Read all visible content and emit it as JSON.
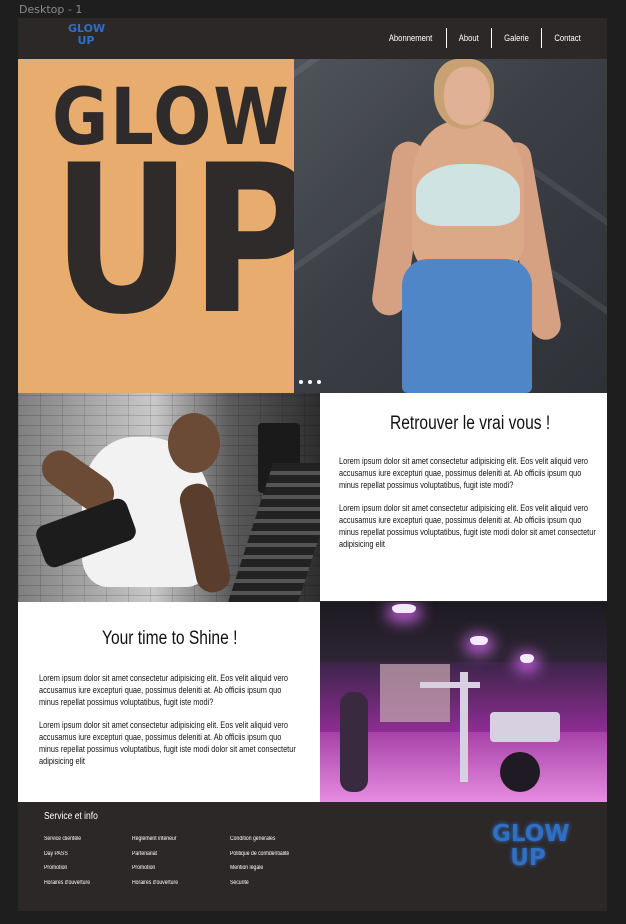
{
  "canvas": {
    "frame_label": "Desktop - 1"
  },
  "header": {
    "logo": {
      "line1": "GLOW",
      "line2": "UP"
    },
    "nav": [
      "Abonnement",
      "About",
      "Galerie",
      "Contact"
    ]
  },
  "hero": {
    "title_line1": "GLOW",
    "title_line2": "UP",
    "carousel_dots": 3
  },
  "section1": {
    "title": "Retrouver le vrai vous !",
    "paragraph1": "Lorem ipsum dolor sit amet consectetur adipisicing elit. Eos velit aliquid vero accusamus iure excepturi quae, possimus deleniti at. Ab officiis ipsum quo minus repellat possimus voluptatibus, fugit iste modi?",
    "paragraph2": "Lorem ipsum dolor sit amet consectetur adipisicing elit. Eos velit aliquid vero accusamus iure excepturi quae, possimus deleniti at. Ab officiis ipsum quo minus repellat possimus voluptatibus, fugit iste modi dolor sit amet consectetur adipisicing elit"
  },
  "section2": {
    "title": "Your time to Shine !",
    "paragraph1": "Lorem ipsum dolor sit amet consectetur adipisicing elit. Eos velit aliquid vero accusamus iure excepturi quae, possimus deleniti at. Ab officiis ipsum quo minus repellat possimus voluptatibus, fugit iste modi?",
    "paragraph2": "Lorem ipsum dolor sit amet consectetur adipisicing elit. Eos velit aliquid vero accusamus iure excepturi quae, possimus deleniti at. Ab officiis ipsum quo minus repellat possimus voluptatibus, fugit iste modi dolor sit amet consectetur adipisicing elit"
  },
  "footer": {
    "title": "Service et info",
    "col1": [
      "Service clientèle",
      "Day PASS",
      "Promotion",
      "Horaires d'ouverture"
    ],
    "col2": [
      "Règlement intérieur",
      "Partenariat",
      "Promotion",
      "Horaires d'ouverture"
    ],
    "col3": [
      "Condition générales",
      "Politique de confidentialité",
      "Mention légale",
      "Sécurité"
    ],
    "logo": {
      "line1": "GLOW",
      "line2": "UP"
    }
  },
  "colors": {
    "background": "#2d2828",
    "accent_orange": "#e8ac6e",
    "logo_blue": "#2f6fc4",
    "panel_white": "#ffffff"
  }
}
